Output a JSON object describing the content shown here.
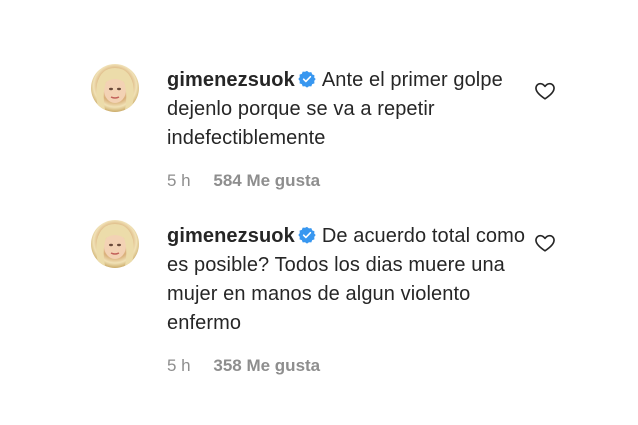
{
  "comments": [
    {
      "username": "gimenezsuok",
      "text": "Ante el primer golpe dejenlo porque se va a repetir indefectiblemente",
      "time": "5 h",
      "likes": "584 Me gusta",
      "verified_color": "#3897f0"
    },
    {
      "username": "gimenezsuok",
      "text": "De acuerdo total como es posible? Todos los dias muere una mujer en manos de algun violento enfermo",
      "time": "5 h",
      "likes": "358 Me gusta",
      "verified_color": "#3897f0"
    }
  ],
  "icons": {
    "verified": "verified-badge-icon",
    "like": "heart-outline-icon"
  }
}
